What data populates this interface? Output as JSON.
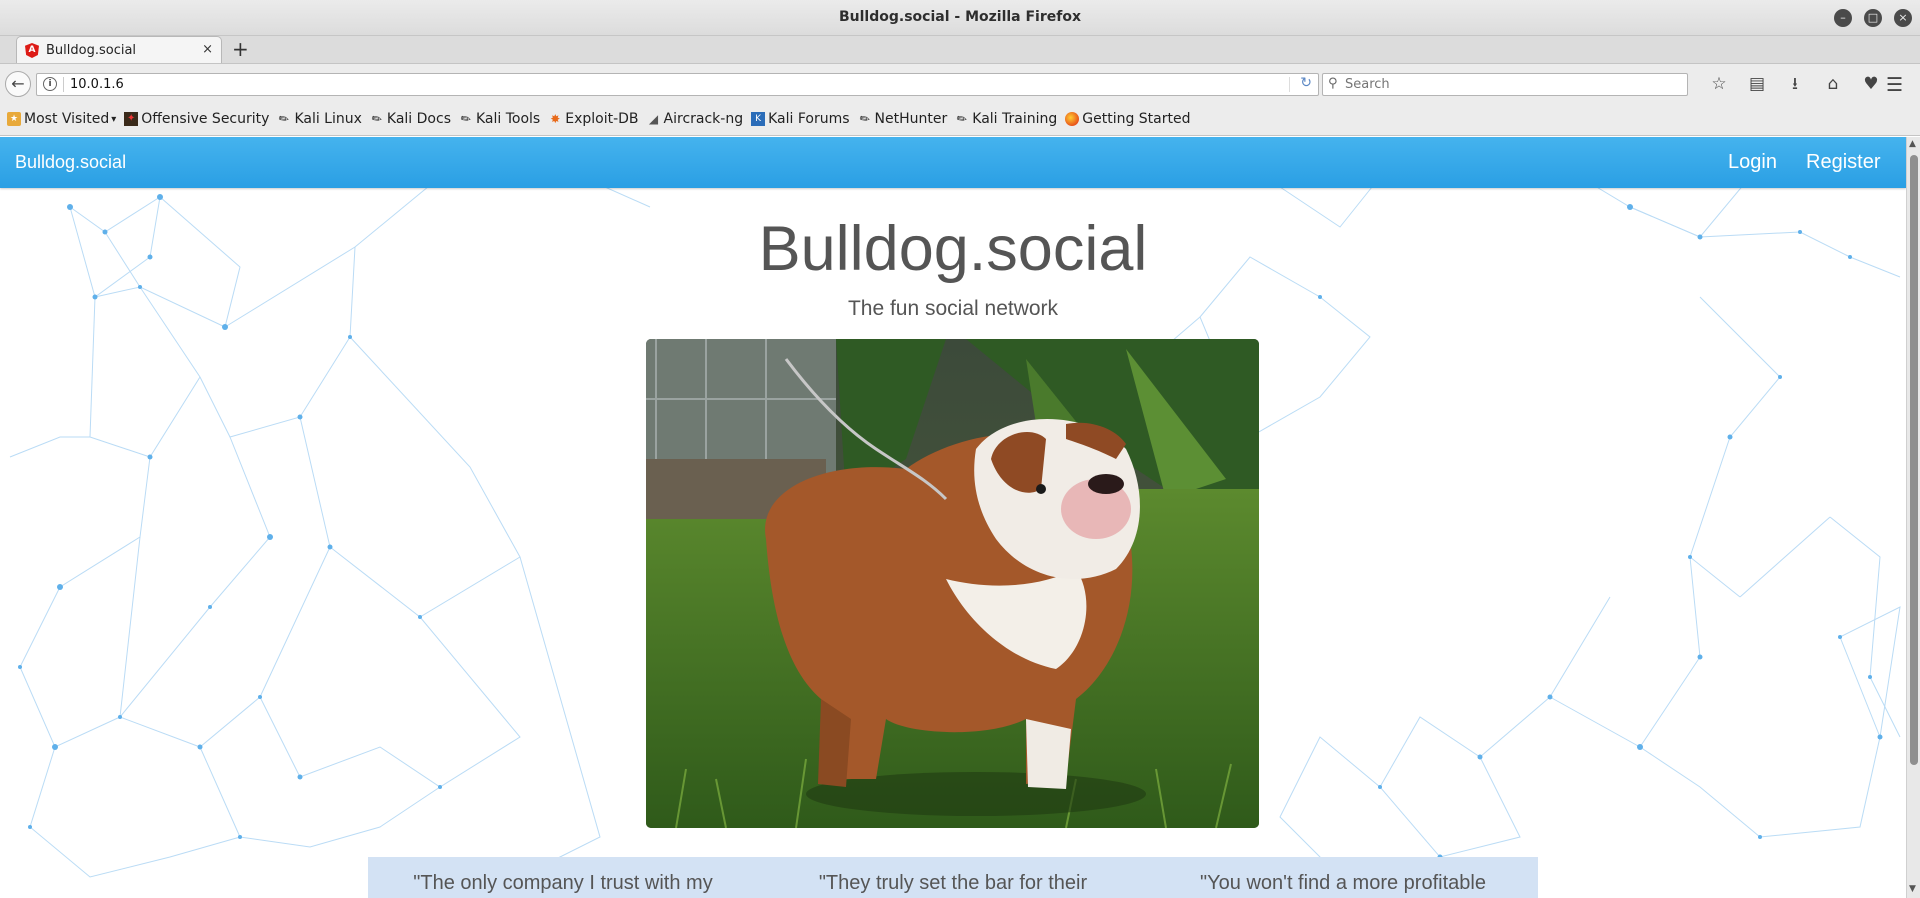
{
  "window": {
    "title": "Bulldog.social - Mozilla Firefox"
  },
  "tab": {
    "label": "Bulldog.social",
    "close": "×",
    "new_tab": "+"
  },
  "navbar": {
    "url": "10.0.1.6",
    "search_placeholder": "Search"
  },
  "bookmarks": [
    {
      "label": "Most Visited",
      "icon": "most-visited-icon"
    },
    {
      "label": "Offensive Security",
      "icon": "offsec-icon"
    },
    {
      "label": "Kali Linux",
      "icon": "kali-icon"
    },
    {
      "label": "Kali Docs",
      "icon": "kali-icon"
    },
    {
      "label": "Kali Tools",
      "icon": "kali-icon"
    },
    {
      "label": "Exploit-DB",
      "icon": "exploit-db-icon"
    },
    {
      "label": "Aircrack-ng",
      "icon": "aircrack-icon"
    },
    {
      "label": "Kali Forums",
      "icon": "kali-forums-icon"
    },
    {
      "label": "NetHunter",
      "icon": "kali-icon"
    },
    {
      "label": "Kali Training",
      "icon": "kali-icon"
    },
    {
      "label": "Getting Started",
      "icon": "firefox-icon"
    }
  ],
  "app": {
    "brand": "Bulldog.social",
    "login": "Login",
    "register": "Register",
    "hero_title": "Bulldog.social",
    "hero_subtitle": "The fun social network"
  },
  "testimonials": [
    "\"The only company I trust with my",
    "\"They truly set the bar for their",
    "\"You won't find a more profitable"
  ],
  "colors": {
    "accent": "#2a9fe4",
    "testimonial_bg": "#d3e2f4"
  }
}
